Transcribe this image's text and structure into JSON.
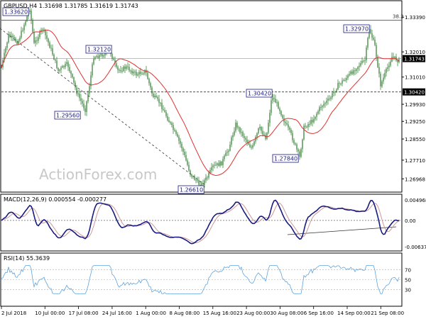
{
  "chart_data": [
    {
      "type": "candlestick",
      "title": "GBPUSD,H4  1.31698 1.31785 1.31619 1.31743",
      "watermark": "ActionForex.com",
      "yticks": [
        "1.33390",
        "1.32010",
        "1.31010",
        "1.29930",
        "1.29250",
        "1.28550",
        "1.27710",
        "1.26968"
      ],
      "right_top_label": "38.2",
      "last_price_label": "1.31743",
      "support_label": "1.30420",
      "annotations": [
        "1.33620",
        "1.32970",
        "1.32120",
        "1.30420",
        "1.29560",
        "1.27840",
        "1.26610"
      ],
      "ma_period_note": "",
      "colors": {
        "candle": "#2a7a2a",
        "ma": "#e03030",
        "hline": "#333333",
        "trend": "#333333"
      }
    },
    {
      "type": "line",
      "title": "MACD(12,26,9) 0.000554 -0.000277",
      "yticks": [
        "0.004968",
        "0.00",
        "-0.006372"
      ],
      "series": [
        {
          "name": "MACD",
          "color": "#1a1a80"
        },
        {
          "name": "Signal",
          "color": "#cc9999"
        }
      ]
    },
    {
      "type": "line",
      "title": "RSI(14) 55.3639",
      "yticks": [
        "70",
        "50",
        "30"
      ],
      "series": [
        {
          "name": "RSI",
          "color": "#5fa3de"
        }
      ]
    }
  ],
  "xaxis": {
    "ticks": [
      "2 Jul 2018",
      "10 Jul 00:00",
      "17 Jul 08:00",
      "24 Jul 16:00",
      "1 Aug 00:00",
      "8 Aug 08:00",
      "15 Aug 16:00",
      "23 Aug 00:00",
      "30 Aug 08:00",
      "6 Sep 16:00",
      "14 Sep 00:00",
      "21 Sep 08:00"
    ]
  }
}
